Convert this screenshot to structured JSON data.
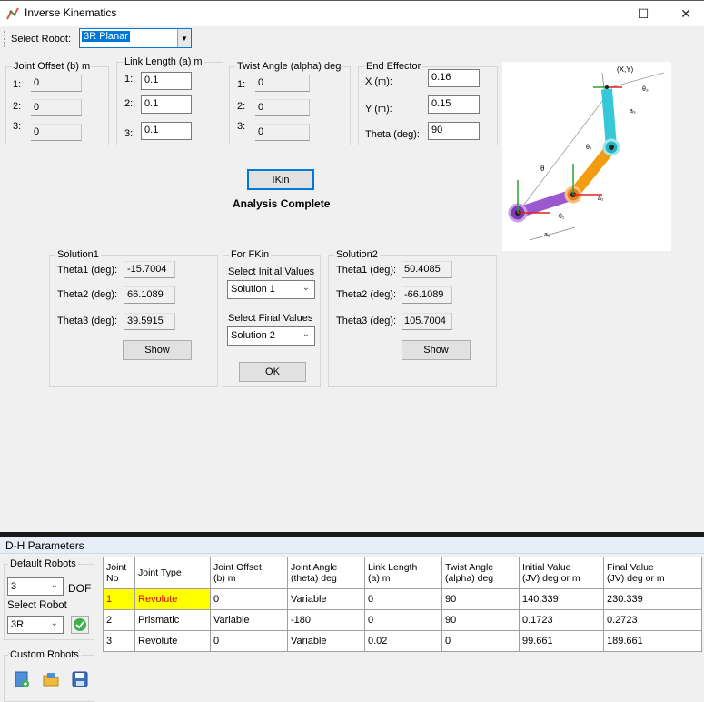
{
  "window": {
    "title": "Inverse Kinematics",
    "minimize": "—",
    "maximize": "☐",
    "close": "✕"
  },
  "toolbar": {
    "select_robot_label": "Select Robot:",
    "select_robot_value": "3R Planar"
  },
  "joint_offset": {
    "title": "Joint Offset (b) m",
    "rows": [
      {
        "idx": "1:",
        "value": "0"
      },
      {
        "idx": "2:",
        "value": "0"
      },
      {
        "idx": "3:",
        "value": "0"
      }
    ]
  },
  "link_length": {
    "title": "Link Length (a) m",
    "rows": [
      {
        "idx": "1:",
        "value": "0.1"
      },
      {
        "idx": "2:",
        "value": "0.1"
      },
      {
        "idx": "3:",
        "value": "0.1"
      }
    ]
  },
  "twist_angle": {
    "title": "Twist Angle (alpha) deg",
    "rows": [
      {
        "idx": "1:",
        "value": "0"
      },
      {
        "idx": "2:",
        "value": "0"
      },
      {
        "idx": "3:",
        "value": "0"
      }
    ]
  },
  "end_effector": {
    "title": "End Effector",
    "x_label": "X (m):",
    "x_value": "0.16",
    "y_label": "Y (m):",
    "y_value": "0.15",
    "theta_label": "Theta (deg):",
    "theta_value": "90"
  },
  "diagram": {
    "xy": "(X,Y)",
    "theta": "θ",
    "theta1": "θ₁",
    "theta2": "θ₂",
    "theta3": "θ₃",
    "a1": "a₁",
    "a2": "a₂",
    "a3": "a₃"
  },
  "ikin": {
    "button": "IKin",
    "status": "Analysis Complete"
  },
  "solution1": {
    "title": "Solution1",
    "t1_label": "Theta1 (deg):",
    "t1": "-15.7004",
    "t2_label": "Theta2 (deg):",
    "t2": "66.1089",
    "t3_label": "Theta3 (deg):",
    "t3": "39.5915",
    "show": "Show"
  },
  "fkin": {
    "title": "For FKin",
    "initial_label": "Select Initial Values",
    "initial_value": "Solution 1",
    "final_label": "Select Final Values",
    "final_value": "Solution 2",
    "ok": "OK"
  },
  "solution2": {
    "title": "Solution2",
    "t1_label": "Theta1 (deg):",
    "t1": "50.4085",
    "t2_label": "Theta2 (deg):",
    "t2": "-66.1089",
    "t3_label": "Theta3 (deg):",
    "t3": "105.7004",
    "show": "Show"
  },
  "dh": {
    "title": "D-H Parameters",
    "default_robots": "Default Robots",
    "dof_value": "3",
    "dof_label": "DOF",
    "select_robot": "Select Robot",
    "robot_value": "3R",
    "custom_robots": "Custom Robots",
    "headers": [
      {
        "l1": "Joint",
        "l2": "No"
      },
      {
        "l1": "Joint Type",
        "l2": ""
      },
      {
        "l1": "Joint Offset",
        "l2": "(b)  m"
      },
      {
        "l1": "Joint Angle",
        "l2": "(theta)  deg"
      },
      {
        "l1": "Link Length",
        "l2": "(a)  m"
      },
      {
        "l1": "Twist Angle",
        "l2": "(alpha)  deg"
      },
      {
        "l1": "Initial Value",
        "l2": "(JV)   deg or m"
      },
      {
        "l1": "Final Value",
        "l2": "(JV)   deg or m"
      }
    ],
    "rows": [
      [
        "1",
        "Revolute",
        "0",
        "Variable",
        "0",
        "90",
        "140.339",
        "230.339"
      ],
      [
        "2",
        "Prismatic",
        "Variable",
        "-180",
        "0",
        "90",
        "0.1723",
        "0.2723"
      ],
      [
        "3",
        "Revolute",
        "0",
        "Variable",
        "0.02",
        "0",
        "99.661",
        "189.661"
      ]
    ],
    "highlight_color": "#ffff00",
    "highlight_text_color": "#e00000"
  }
}
